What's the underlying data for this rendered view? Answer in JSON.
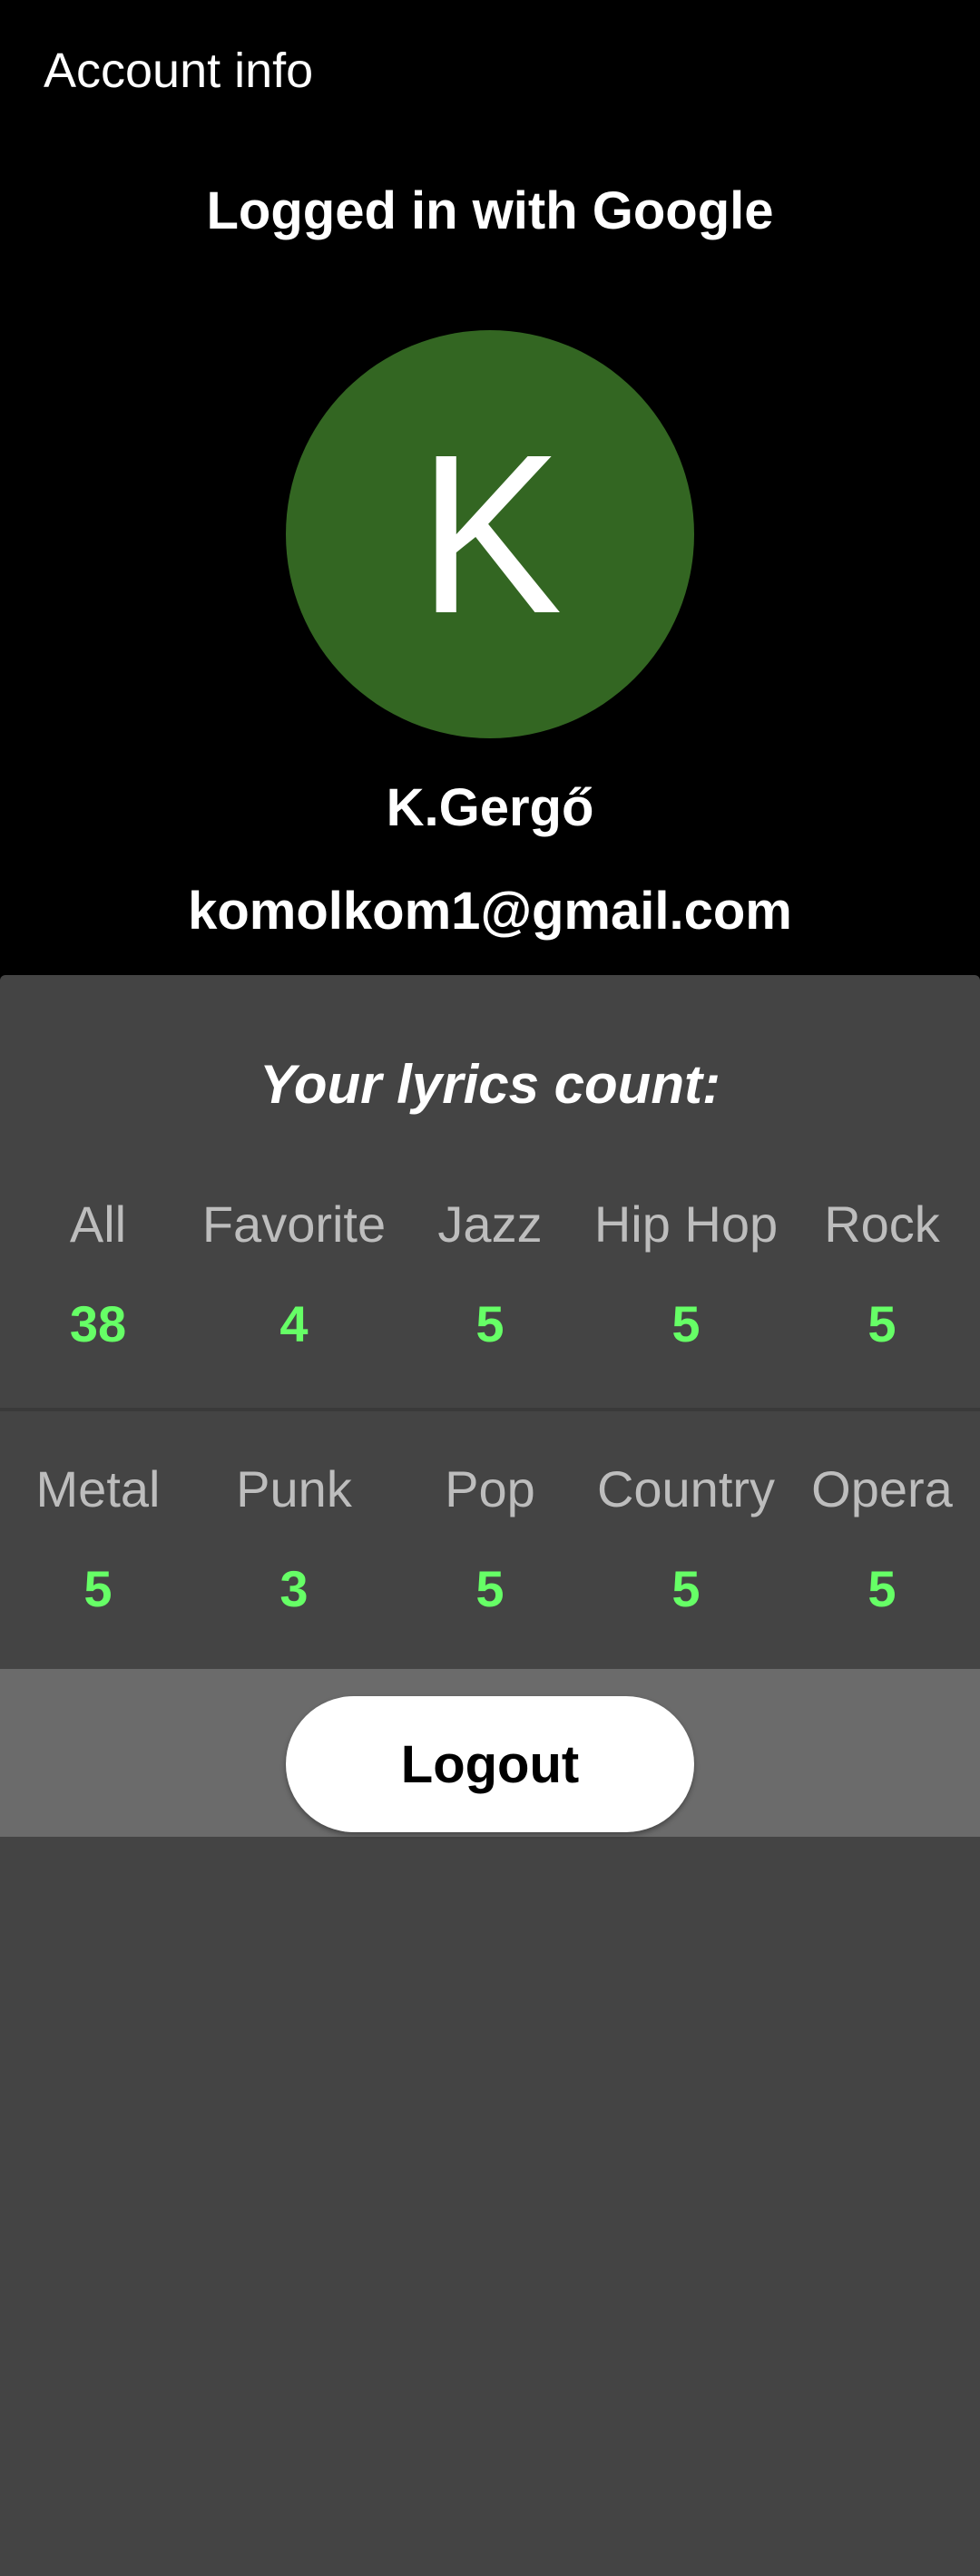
{
  "header": {
    "title": "Account info"
  },
  "account": {
    "login_method": "Logged in with Google",
    "avatar_letter": "K",
    "avatar_color": "#336622",
    "name": "K.Gergő",
    "email": "komolkom1@gmail.com"
  },
  "stats": {
    "heading": "Your lyrics count:",
    "value_color": "#66ff66",
    "row1": [
      {
        "label": "All",
        "value": "38"
      },
      {
        "label": "Favorite",
        "value": "4"
      },
      {
        "label": "Jazz",
        "value": "5"
      },
      {
        "label": "Hip Hop",
        "value": "5"
      },
      {
        "label": "Rock",
        "value": "5"
      }
    ],
    "row2": [
      {
        "label": "Metal",
        "value": "5"
      },
      {
        "label": "Punk",
        "value": "3"
      },
      {
        "label": "Pop",
        "value": "5"
      },
      {
        "label": "Country",
        "value": "5"
      },
      {
        "label": "Opera",
        "value": "5"
      }
    ]
  },
  "actions": {
    "logout_label": "Logout"
  }
}
